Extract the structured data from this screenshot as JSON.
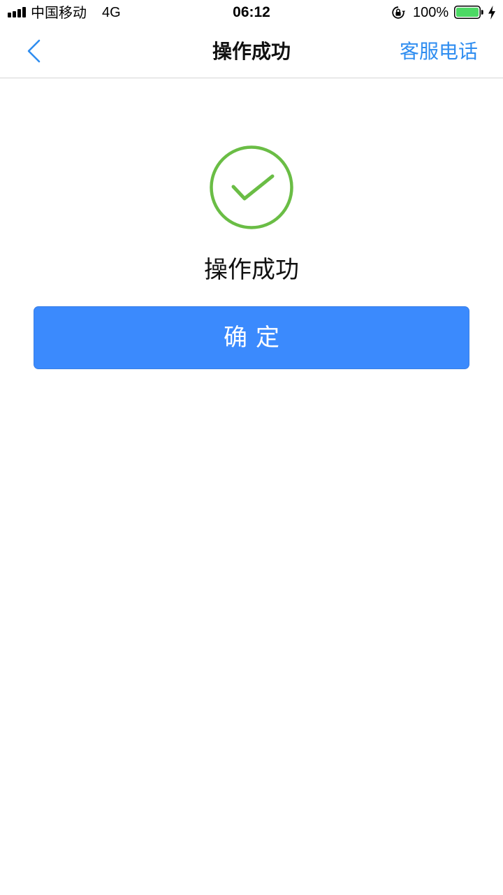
{
  "status_bar": {
    "carrier": "中国移动",
    "network": "4G",
    "time": "06:12",
    "battery_percent": "100%",
    "signal_level": 4,
    "battery_level": 1.0,
    "icons": [
      "signal-icon",
      "orientation-lock-icon",
      "battery-icon",
      "charging-icon"
    ]
  },
  "nav": {
    "title": "操作成功",
    "action_label": "客服电话",
    "back_icon": "chevron-left-icon"
  },
  "result": {
    "icon": "check-circle-icon",
    "message": "操作成功",
    "confirm_label": "确定"
  },
  "colors": {
    "accent": "#2f8df0",
    "button": "#3b8afd",
    "success": "#6abd45"
  }
}
